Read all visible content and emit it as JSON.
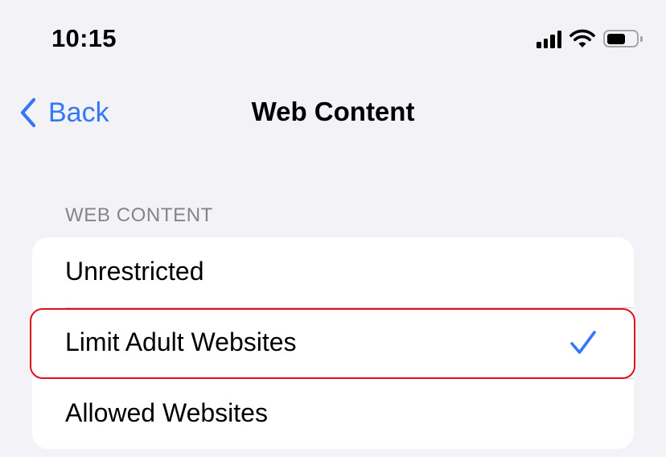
{
  "status_bar": {
    "time": "10:15",
    "icons": [
      "cellular-signal-icon",
      "wifi-icon",
      "battery-icon"
    ],
    "battery_level": 0.65
  },
  "nav": {
    "back_label": "Back",
    "title": "Web Content"
  },
  "section": {
    "header": "WEB CONTENT",
    "options": [
      {
        "label": "Unrestricted",
        "selected": false
      },
      {
        "label": "Limit Adult Websites",
        "selected": true
      },
      {
        "label": "Allowed Websites",
        "selected": false
      }
    ]
  },
  "colors": {
    "accent": "#3478f6",
    "background": "#f2f2f7",
    "highlight": "#e0101e"
  }
}
